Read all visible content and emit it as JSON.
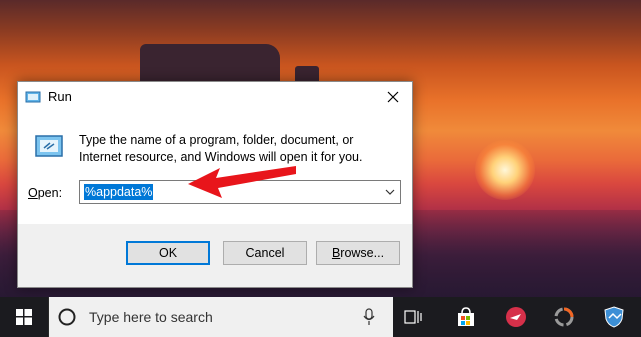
{
  "dialog": {
    "title": "Run",
    "description": "Type the name of a program, folder, document, or Internet resource, and Windows will open it for you.",
    "open_label_accel": "O",
    "open_label_rest": "pen:",
    "open_value": "%appdata%",
    "ok_label": "OK",
    "cancel_label": "Cancel",
    "browse_label_accel": "B",
    "browse_label_rest": "rowse..."
  },
  "taskbar": {
    "search_placeholder": "Type here to search",
    "icons": [
      "windows-start-icon",
      "cortana-icon",
      "microphone-icon",
      "task-view-icon",
      "store-icon",
      "app-icon-red",
      "app-icon-ring",
      "defender-shield-icon"
    ]
  },
  "colors": {
    "accent": "#0078d7",
    "arrow": "#e8151b",
    "taskbar": "#1b1b1f"
  }
}
